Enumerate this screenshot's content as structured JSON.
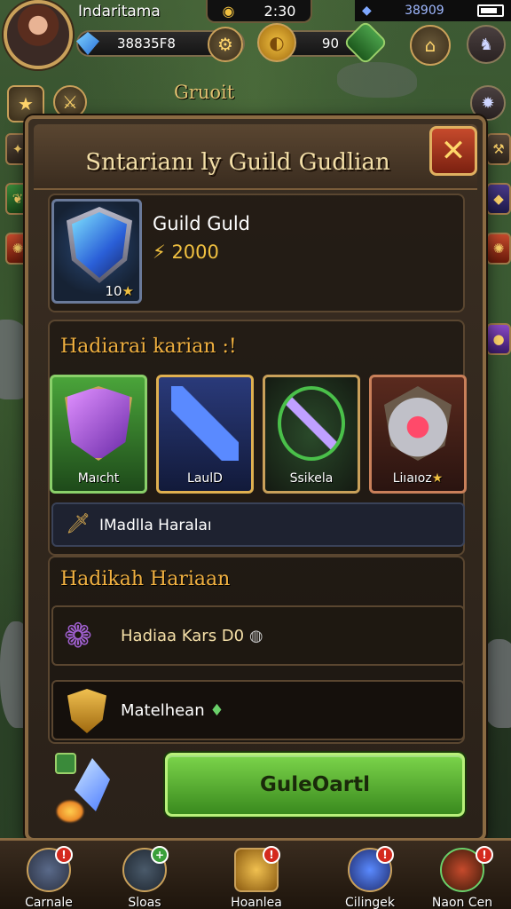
{
  "status_bar": {
    "time": "2:30",
    "signal_value": "38909"
  },
  "player": {
    "name": "Indaritama"
  },
  "currencies": {
    "gems": "38835F8",
    "gold": "90"
  },
  "guild_label": "Gruoit",
  "panel": {
    "title": "Sntarianı ly Guild Gudlian",
    "close_symbol": "✕",
    "guild": {
      "name": "Guild Guld",
      "power": "2000",
      "emblem_level": "10"
    },
    "rewards_heading": "Hadiarai karian :!",
    "rewards": [
      {
        "label": "Maıcht",
        "color": "#3d8a2a"
      },
      {
        "label": "LaulD",
        "color": "#2a3a6a"
      },
      {
        "label": "Ssikela",
        "color": "#1e2a1a"
      },
      {
        "label": "Liıaıoz",
        "color": "#4a2a1e"
      }
    ],
    "bar_label": "IMadlla Haralaı",
    "daily_heading": "Hadikah Hariaan",
    "list_items": [
      {
        "label": "Hadiaa Kars  D0"
      },
      {
        "label": "Matelhean"
      }
    ],
    "claim_button": "GuleOartl"
  },
  "bottom_nav": [
    {
      "label": "Carnale",
      "badge": "!"
    },
    {
      "label": "Sloas",
      "badge": "+"
    },
    {
      "label": "Hoanlea",
      "badge": "!"
    },
    {
      "label": "Cilingek",
      "badge": "!"
    },
    {
      "label": "Naon Cen",
      "badge": "!"
    }
  ],
  "colors": {
    "accent_gold": "#c9a05a",
    "claim_green": "#5ab02e",
    "close_red": "#c64a2c"
  }
}
